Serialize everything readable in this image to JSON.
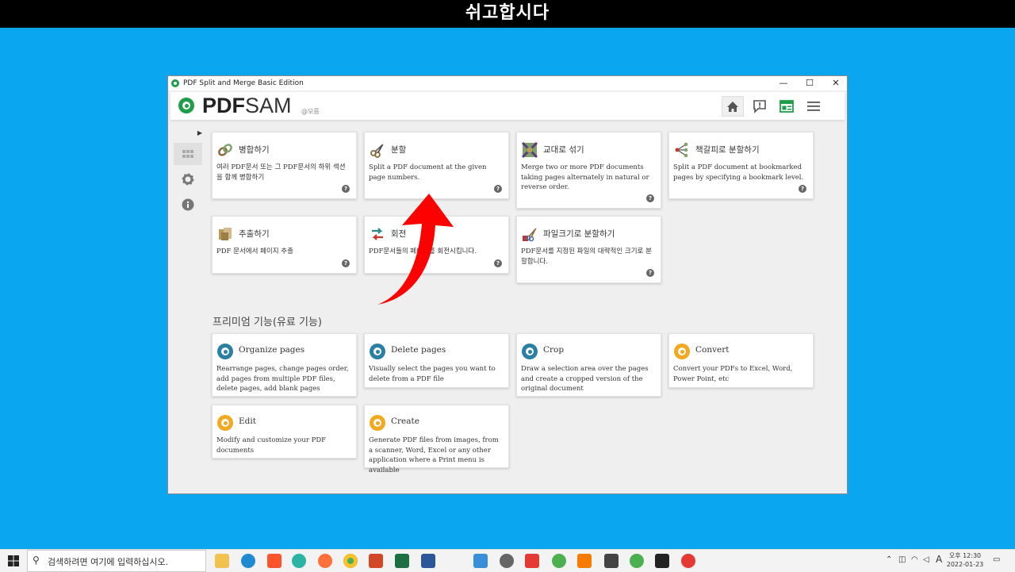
{
  "banner": {
    "text": "쉬고합시다"
  },
  "window": {
    "title": "PDF Split and Merge Basic Edition",
    "controls": {
      "minimize": "—",
      "maximize": "☐",
      "close": "✕"
    }
  },
  "header": {
    "logo_bold": "PDF",
    "logo_light": "SAM",
    "logo_sub": "@모름"
  },
  "tools": [
    {
      "title": "병합하기",
      "desc": "여러 PDF문서 또는 그 PDF문서의 하위 섹션을 함께 병합하기",
      "icon": "chain-link-icon"
    },
    {
      "title": "분할",
      "desc": "Split a PDF document at the given page numbers.",
      "icon": "scissors-icon"
    },
    {
      "title": "교대로 섞기",
      "desc": "Merge two or more PDF documents taking pages alternately in natural or reverse order.",
      "icon": "alternate-mix-icon"
    },
    {
      "title": "책갈피로 분할하기",
      "desc": "Split a PDF document at bookmarked pages by specifying a bookmark level.",
      "icon": "bookmark-tree-icon"
    },
    {
      "title": "추출하기",
      "desc": "PDF 문서에서 페이지 추출",
      "icon": "extract-boxes-icon"
    },
    {
      "title": "회전",
      "desc": "PDF문서들의 페이지를 회전시킵니다.",
      "icon": "rotate-icon"
    },
    {
      "title": "파일크기로 분할하기",
      "desc": "PDF문서를 지정된 파일의 대략적인 크기로 분할합니다.",
      "icon": "size-scissors-icon"
    }
  ],
  "premium": {
    "section_title": "프리미엄 기능(유료 기능)",
    "items": [
      {
        "title": "Organize pages",
        "desc": "Rearrange pages, change pages order, add pages from multiple PDF files, delete pages, add blank pages",
        "icon": "pdfsam-blue-icon"
      },
      {
        "title": "Delete pages",
        "desc": "Visually select the pages you want to delete from a PDF file",
        "icon": "pdfsam-blue-icon"
      },
      {
        "title": "Crop",
        "desc": "Draw a selection area over the pages and create a cropped version of the original document",
        "icon": "pdfsam-blue-icon"
      },
      {
        "title": "Convert",
        "desc": "Convert your PDFs to Excel, Word, Power Point, etc",
        "icon": "pdfsam-orange-icon"
      },
      {
        "title": "Edit",
        "desc": "Modify and customize your PDF documents",
        "icon": "pdfsam-orange-icon"
      },
      {
        "title": "Create",
        "desc": "Generate PDF files from images, from a scanner, Word, Excel or any other application where a Print menu is available",
        "icon": "pdfsam-orange-icon"
      }
    ]
  },
  "help_label": "?",
  "taskbar": {
    "search_placeholder": "검색하려면 여기에 입력하십시오.",
    "ime": "A",
    "clock_time": "오후 12:30",
    "clock_date": "2022-01-23"
  },
  "colors": {
    "desktop": "#0aa6f0",
    "accent_green": "#1e9e48",
    "arrow_red": "#ff0000"
  }
}
